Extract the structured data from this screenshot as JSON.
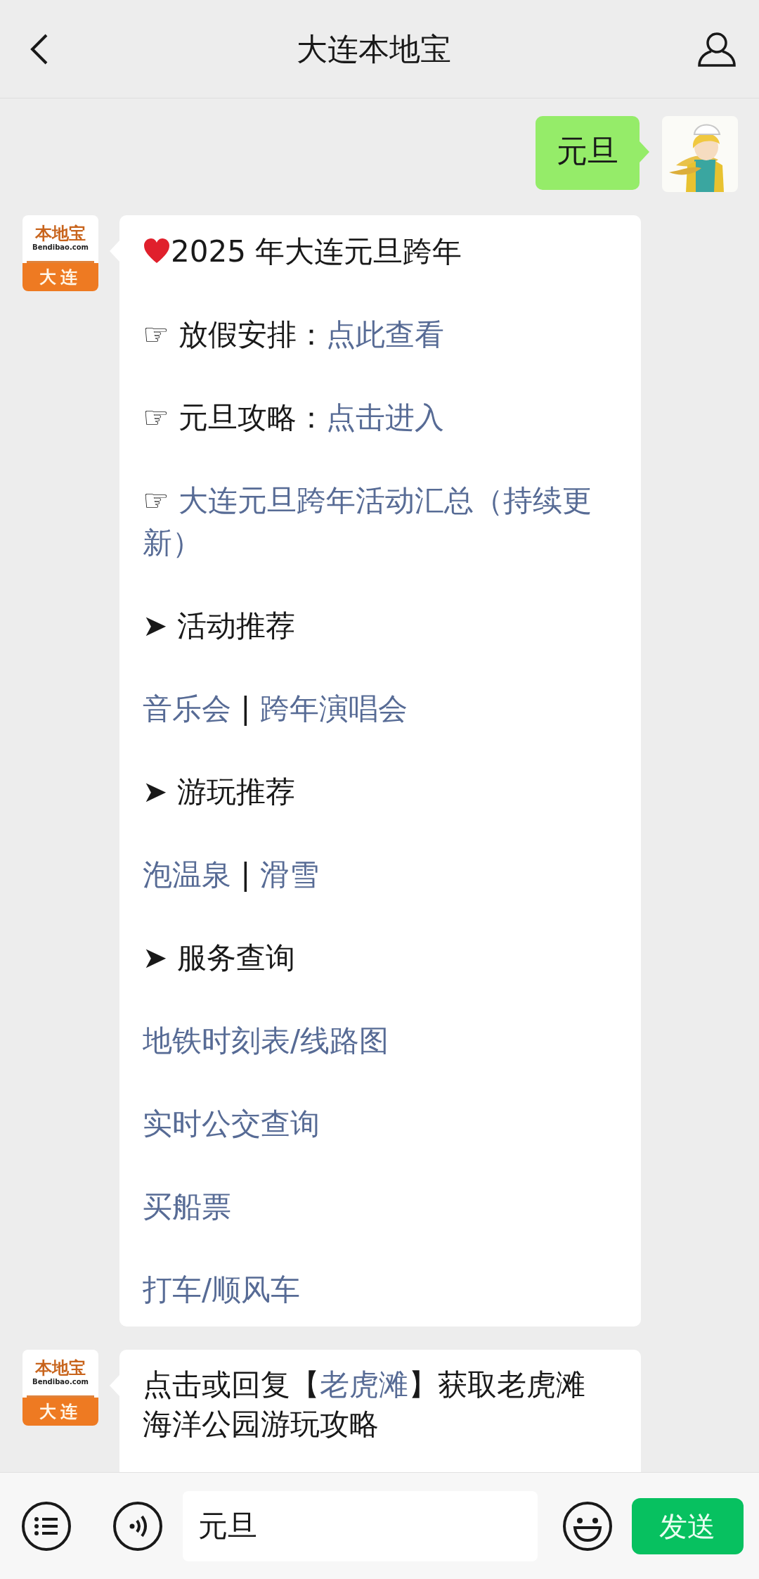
{
  "header": {
    "title": "大连本地宝"
  },
  "messages": [
    {
      "kind": "outgoing",
      "avatar": {
        "kind": "picture"
      },
      "paragraphs": [
        {
          "kind": "line",
          "segments": [
            {
              "text": "元旦",
              "link": false
            }
          ]
        }
      ]
    },
    {
      "kind": "incoming",
      "avatar": {
        "kind": "logo",
        "title": "本地宝",
        "site": "Bendibao.com",
        "city": "大连"
      },
      "paragraphs": [
        {
          "kind": "heart_title",
          "segments": [
            {
              "text": "2025 年大连元旦跨年",
              "link": false
            }
          ]
        },
        {
          "kind": "text",
          "segments": [
            {
              "text": "☞ 放假安排：",
              "link": false
            },
            {
              "text": "点此查看",
              "link": true
            }
          ]
        },
        {
          "kind": "text",
          "segments": [
            {
              "text": "☞ 元旦攻略：",
              "link": false
            },
            {
              "text": "点击进入",
              "link": true
            }
          ]
        },
        {
          "kind": "link_line",
          "segments": [
            {
              "text": "☞ ",
              "link": false
            },
            {
              "text": "大连元旦跨年活动汇总（持续更新）",
              "link": true
            }
          ]
        },
        {
          "kind": "text",
          "segments": [
            {
              "text": "➤ 活动推荐",
              "link": false
            }
          ]
        },
        {
          "kind": "text",
          "segments": [
            {
              "text": "音乐会",
              "link": true
            },
            {
              "text": " | ",
              "link": false
            },
            {
              "text": "跨年演唱会",
              "link": true
            }
          ]
        },
        {
          "kind": "text",
          "segments": [
            {
              "text": "➤ 游玩推荐",
              "link": false
            }
          ]
        },
        {
          "kind": "text",
          "segments": [
            {
              "text": "泡温泉",
              "link": true
            },
            {
              "text": " | ",
              "link": false
            },
            {
              "text": "滑雪",
              "link": true
            }
          ]
        },
        {
          "kind": "text",
          "segments": [
            {
              "text": "➤ 服务查询",
              "link": false
            }
          ]
        },
        {
          "kind": "text",
          "segments": [
            {
              "text": "地铁时刻表/线路图",
              "link": true
            }
          ]
        },
        {
          "kind": "text",
          "segments": [
            {
              "text": "实时公交查询",
              "link": true
            }
          ]
        },
        {
          "kind": "text",
          "segments": [
            {
              "text": "买船票",
              "link": true
            }
          ]
        },
        {
          "kind": "text",
          "segments": [
            {
              "text": "打车/顺风车",
              "link": true
            }
          ]
        }
      ]
    },
    {
      "kind": "incoming",
      "avatar": {
        "kind": "logo",
        "title": "本地宝",
        "site": "Bendibao.com",
        "city": "大连"
      },
      "paragraphs": [
        {
          "kind": "line",
          "segments": [
            {
              "text": "点击或回复【",
              "link": false
            },
            {
              "text": "老虎滩",
              "link": true
            },
            {
              "text": "】获取老虎滩海洋公园游玩攻略",
              "link": false
            }
          ]
        }
      ]
    }
  ],
  "input_bar": {
    "value": "元旦",
    "send_button": "发送"
  }
}
